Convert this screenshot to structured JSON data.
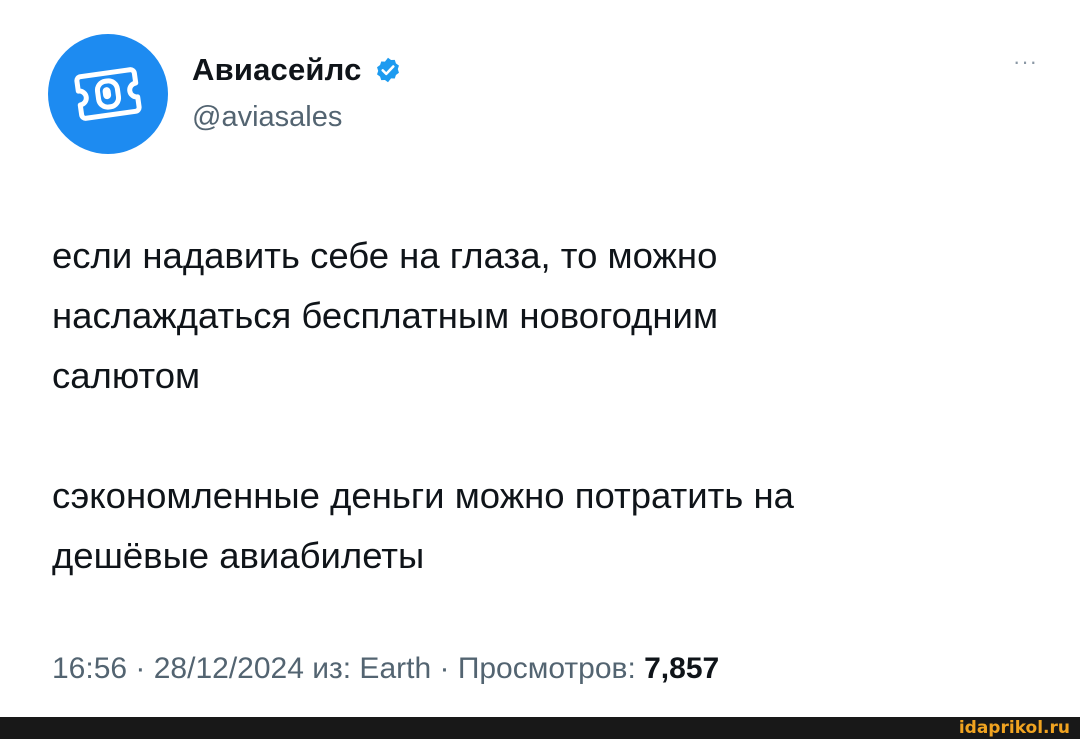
{
  "author": {
    "display_name": "Авиасейлс",
    "handle": "@aviasales",
    "verified_icon": "verified-badge-icon",
    "avatar_icon": "aviasales-logo-icon",
    "avatar_color": "#1d8bf1"
  },
  "more_menu": {
    "icon": "more-horizontal-icon",
    "label": "···"
  },
  "tweet": {
    "paragraph_1": "если надавить себе на глаза, то можно\nнаслаждаться бесплатным новогодним\nсалютом",
    "paragraph_2": "сэкономленные деньги можно потратить на\nдешёвые авиабилеты"
  },
  "meta": {
    "time": "16:56",
    "separator": " · ",
    "date": "28/12/2024",
    "source": "из: Earth",
    "views_label": "Просмотров:",
    "views_count": "7,857"
  },
  "watermark": {
    "text": "idaprikol.ru",
    "color": "#f0a320"
  }
}
